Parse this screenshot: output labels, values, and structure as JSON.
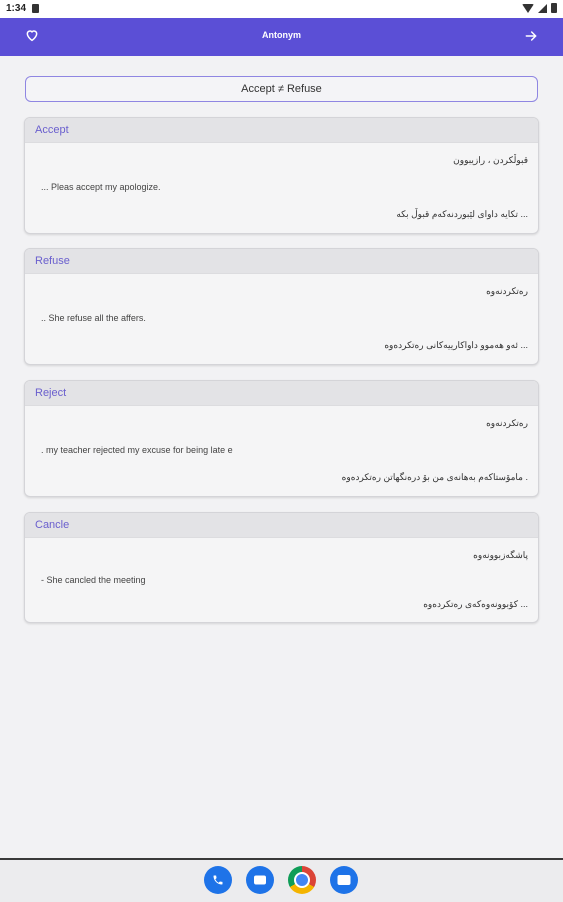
{
  "status_bar": {
    "time": "1:34"
  },
  "app_bar": {
    "title": "Antonym"
  },
  "pair_label": "Accept ≠ Refuse",
  "cards": [
    {
      "word": "Accept",
      "translation": "قبوڵکردن ، رازیبوون",
      "example_en": "... Pleas accept my apologize.",
      "example_ku": "... تکایە داوای لێبوردنەکەم قبوڵ بکە"
    },
    {
      "word": "Refuse",
      "translation": "رەتکردنەوە",
      "example_en": ".. She refuse all the affers.",
      "example_ku": "... ئەو هەموو داواکارییەکانی رەتکردەوە"
    },
    {
      "word": "Reject",
      "translation": "رەتکردنەوە",
      "example_en": ". my teacher rejected my excuse for being late e",
      "example_ku": ". مامۆستاکەم بەهانەی من بۆ درەنگهاتن رەتکردەوە"
    },
    {
      "word": "Cancle",
      "translation": "پاشگەزبوونەوە",
      "example_en": "- She cancled the meeting",
      "example_ku": "... کۆبوونەوەکەی رەتکردەوە"
    }
  ],
  "dock": {
    "apps": [
      "phone-icon",
      "messages-icon",
      "chrome-icon",
      "camera-icon"
    ]
  },
  "colors": {
    "app_bar": "#5b4fd6",
    "accent": "#6a5fce",
    "background": "#f2f2f4"
  }
}
